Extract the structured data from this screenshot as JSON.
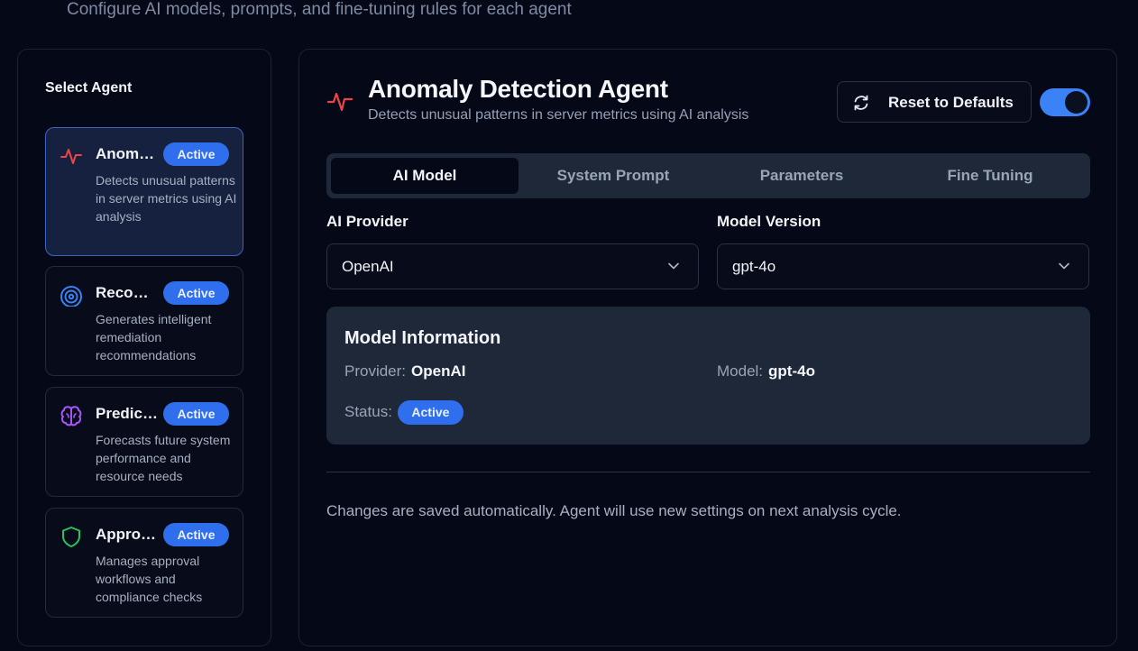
{
  "header": {
    "subtitle": "Configure AI models, prompts, and fine-tuning rules for each agent"
  },
  "sidebar": {
    "title": "Select Agent",
    "agents": [
      {
        "name": "Anomaly Detection Agent",
        "badge": "Active",
        "description": "Detects unusual patterns in server metrics using AI analysis",
        "icon": "activity-pulse-icon",
        "color": "#ef4444",
        "selected": true
      },
      {
        "name": "Recommendation Agent",
        "badge": "Active",
        "description": "Generates intelligent remediation recommendations",
        "icon": "target-icon",
        "color": "#3b82f6",
        "selected": false
      },
      {
        "name": "Prediction Agent",
        "badge": "Active",
        "description": "Forecasts future system performance and resource needs",
        "icon": "brain-icon",
        "color": "#a855f7",
        "selected": false
      },
      {
        "name": "Approval Agent",
        "badge": "Active",
        "description": "Manages approval workflows and compliance checks",
        "icon": "shield-icon",
        "color": "#22c55e",
        "selected": false
      }
    ]
  },
  "main": {
    "title": "Anomaly Detection Agent",
    "subtitle": "Detects unusual patterns in server metrics using AI analysis",
    "reset_label": "Reset to Defaults",
    "enabled": true,
    "tabs": [
      "AI Model",
      "System Prompt",
      "Parameters",
      "Fine Tuning"
    ],
    "active_tab": "AI Model",
    "provider_label": "AI Provider",
    "provider_value": "OpenAI",
    "model_label": "Model Version",
    "model_value": "gpt-4o",
    "info": {
      "title": "Model Information",
      "provider_key": "Provider:",
      "provider_val": "OpenAI",
      "model_key": "Model:",
      "model_val": "gpt-4o",
      "status_key": "Status:",
      "status_val": "Active"
    },
    "footer_note": "Changes are saved automatically. Agent will use new settings on next analysis cycle."
  },
  "colors": {
    "accent": "#3b82f6",
    "badge": "#2f6fed",
    "background": "#050816",
    "panel": "#1e2838"
  }
}
